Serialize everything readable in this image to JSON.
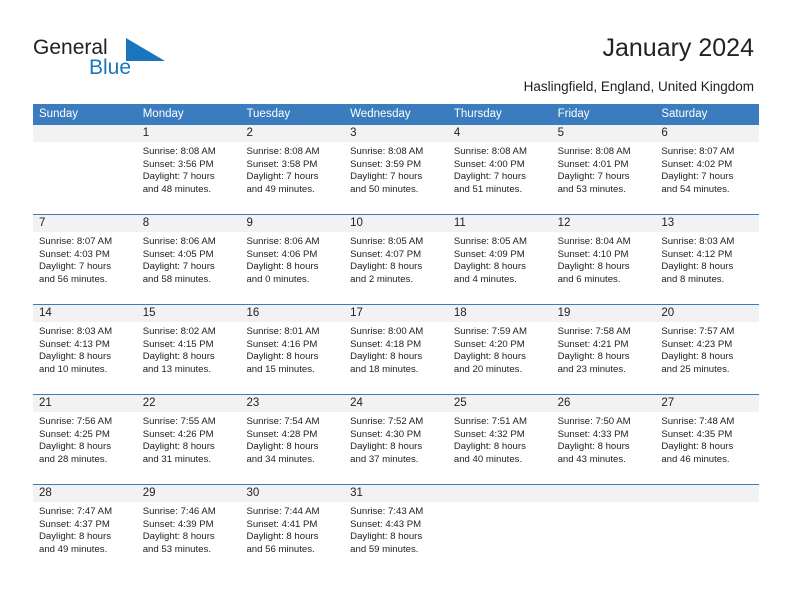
{
  "brand": {
    "name_part1": "General",
    "name_part2": "Blue",
    "triangle_icon": "triangle-icon",
    "color_dark": "#231f20",
    "color_blue": "#1b75bc"
  },
  "header": {
    "title": "January 2024",
    "subtitle": "Haslingfield, England, United Kingdom"
  },
  "calendar": {
    "header_bg": "#3b7cbf",
    "daynum_bg": "#f2f2f2",
    "weekdays": [
      "Sunday",
      "Monday",
      "Tuesday",
      "Wednesday",
      "Thursday",
      "Friday",
      "Saturday"
    ],
    "weeks": [
      [
        {
          "day": "",
          "lines": []
        },
        {
          "day": "1",
          "lines": [
            "Sunrise: 8:08 AM",
            "Sunset: 3:56 PM",
            "Daylight: 7 hours",
            "and 48 minutes."
          ]
        },
        {
          "day": "2",
          "lines": [
            "Sunrise: 8:08 AM",
            "Sunset: 3:58 PM",
            "Daylight: 7 hours",
            "and 49 minutes."
          ]
        },
        {
          "day": "3",
          "lines": [
            "Sunrise: 8:08 AM",
            "Sunset: 3:59 PM",
            "Daylight: 7 hours",
            "and 50 minutes."
          ]
        },
        {
          "day": "4",
          "lines": [
            "Sunrise: 8:08 AM",
            "Sunset: 4:00 PM",
            "Daylight: 7 hours",
            "and 51 minutes."
          ]
        },
        {
          "day": "5",
          "lines": [
            "Sunrise: 8:08 AM",
            "Sunset: 4:01 PM",
            "Daylight: 7 hours",
            "and 53 minutes."
          ]
        },
        {
          "day": "6",
          "lines": [
            "Sunrise: 8:07 AM",
            "Sunset: 4:02 PM",
            "Daylight: 7 hours",
            "and 54 minutes."
          ]
        }
      ],
      [
        {
          "day": "7",
          "lines": [
            "Sunrise: 8:07 AM",
            "Sunset: 4:03 PM",
            "Daylight: 7 hours",
            "and 56 minutes."
          ]
        },
        {
          "day": "8",
          "lines": [
            "Sunrise: 8:06 AM",
            "Sunset: 4:05 PM",
            "Daylight: 7 hours",
            "and 58 minutes."
          ]
        },
        {
          "day": "9",
          "lines": [
            "Sunrise: 8:06 AM",
            "Sunset: 4:06 PM",
            "Daylight: 8 hours",
            "and 0 minutes."
          ]
        },
        {
          "day": "10",
          "lines": [
            "Sunrise: 8:05 AM",
            "Sunset: 4:07 PM",
            "Daylight: 8 hours",
            "and 2 minutes."
          ]
        },
        {
          "day": "11",
          "lines": [
            "Sunrise: 8:05 AM",
            "Sunset: 4:09 PM",
            "Daylight: 8 hours",
            "and 4 minutes."
          ]
        },
        {
          "day": "12",
          "lines": [
            "Sunrise: 8:04 AM",
            "Sunset: 4:10 PM",
            "Daylight: 8 hours",
            "and 6 minutes."
          ]
        },
        {
          "day": "13",
          "lines": [
            "Sunrise: 8:03 AM",
            "Sunset: 4:12 PM",
            "Daylight: 8 hours",
            "and 8 minutes."
          ]
        }
      ],
      [
        {
          "day": "14",
          "lines": [
            "Sunrise: 8:03 AM",
            "Sunset: 4:13 PM",
            "Daylight: 8 hours",
            "and 10 minutes."
          ]
        },
        {
          "day": "15",
          "lines": [
            "Sunrise: 8:02 AM",
            "Sunset: 4:15 PM",
            "Daylight: 8 hours",
            "and 13 minutes."
          ]
        },
        {
          "day": "16",
          "lines": [
            "Sunrise: 8:01 AM",
            "Sunset: 4:16 PM",
            "Daylight: 8 hours",
            "and 15 minutes."
          ]
        },
        {
          "day": "17",
          "lines": [
            "Sunrise: 8:00 AM",
            "Sunset: 4:18 PM",
            "Daylight: 8 hours",
            "and 18 minutes."
          ]
        },
        {
          "day": "18",
          "lines": [
            "Sunrise: 7:59 AM",
            "Sunset: 4:20 PM",
            "Daylight: 8 hours",
            "and 20 minutes."
          ]
        },
        {
          "day": "19",
          "lines": [
            "Sunrise: 7:58 AM",
            "Sunset: 4:21 PM",
            "Daylight: 8 hours",
            "and 23 minutes."
          ]
        },
        {
          "day": "20",
          "lines": [
            "Sunrise: 7:57 AM",
            "Sunset: 4:23 PM",
            "Daylight: 8 hours",
            "and 25 minutes."
          ]
        }
      ],
      [
        {
          "day": "21",
          "lines": [
            "Sunrise: 7:56 AM",
            "Sunset: 4:25 PM",
            "Daylight: 8 hours",
            "and 28 minutes."
          ]
        },
        {
          "day": "22",
          "lines": [
            "Sunrise: 7:55 AM",
            "Sunset: 4:26 PM",
            "Daylight: 8 hours",
            "and 31 minutes."
          ]
        },
        {
          "day": "23",
          "lines": [
            "Sunrise: 7:54 AM",
            "Sunset: 4:28 PM",
            "Daylight: 8 hours",
            "and 34 minutes."
          ]
        },
        {
          "day": "24",
          "lines": [
            "Sunrise: 7:52 AM",
            "Sunset: 4:30 PM",
            "Daylight: 8 hours",
            "and 37 minutes."
          ]
        },
        {
          "day": "25",
          "lines": [
            "Sunrise: 7:51 AM",
            "Sunset: 4:32 PM",
            "Daylight: 8 hours",
            "and 40 minutes."
          ]
        },
        {
          "day": "26",
          "lines": [
            "Sunrise: 7:50 AM",
            "Sunset: 4:33 PM",
            "Daylight: 8 hours",
            "and 43 minutes."
          ]
        },
        {
          "day": "27",
          "lines": [
            "Sunrise: 7:48 AM",
            "Sunset: 4:35 PM",
            "Daylight: 8 hours",
            "and 46 minutes."
          ]
        }
      ],
      [
        {
          "day": "28",
          "lines": [
            "Sunrise: 7:47 AM",
            "Sunset: 4:37 PM",
            "Daylight: 8 hours",
            "and 49 minutes."
          ]
        },
        {
          "day": "29",
          "lines": [
            "Sunrise: 7:46 AM",
            "Sunset: 4:39 PM",
            "Daylight: 8 hours",
            "and 53 minutes."
          ]
        },
        {
          "day": "30",
          "lines": [
            "Sunrise: 7:44 AM",
            "Sunset: 4:41 PM",
            "Daylight: 8 hours",
            "and 56 minutes."
          ]
        },
        {
          "day": "31",
          "lines": [
            "Sunrise: 7:43 AM",
            "Sunset: 4:43 PM",
            "Daylight: 8 hours",
            "and 59 minutes."
          ]
        },
        {
          "day": "",
          "lines": []
        },
        {
          "day": "",
          "lines": []
        },
        {
          "day": "",
          "lines": []
        }
      ]
    ]
  }
}
